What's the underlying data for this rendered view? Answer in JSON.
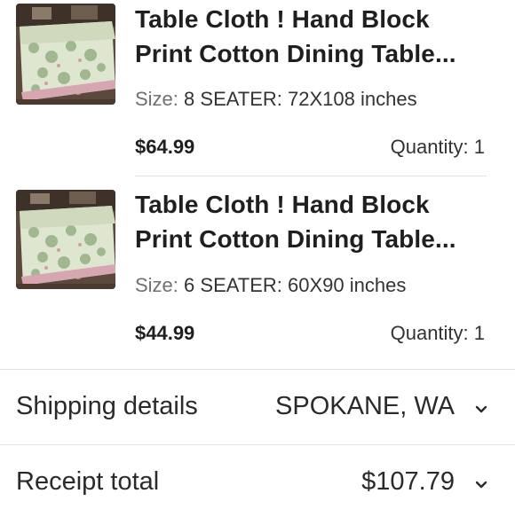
{
  "items": [
    {
      "title_line1": "Table Cloth ! Hand Block",
      "title_line2": "Print Cotton Dining Table...",
      "size_label": "Size:",
      "size_value": "8 SEATER: 72X108 inches",
      "price": "$64.99",
      "quantity_label": "Quantity: 1",
      "thumbnail": "tablecloth-photo"
    },
    {
      "title_line1": "Table Cloth ! Hand Block",
      "title_line2": "Print Cotton Dining Table...",
      "size_label": "Size:",
      "size_value": "6 SEATER: 60X90 inches",
      "price": "$44.99",
      "quantity_label": "Quantity: 1",
      "thumbnail": "tablecloth-photo"
    }
  ],
  "shipping": {
    "label": "Shipping details",
    "value": "SPOKANE, WA",
    "icon": "chevron-down-icon"
  },
  "receipt": {
    "label": "Receipt total",
    "value": "$107.79",
    "icon": "chevron-down-icon"
  },
  "colors": {
    "text": "#1f1f1f",
    "muted": "#707070",
    "divider": "#e2e2e2"
  }
}
